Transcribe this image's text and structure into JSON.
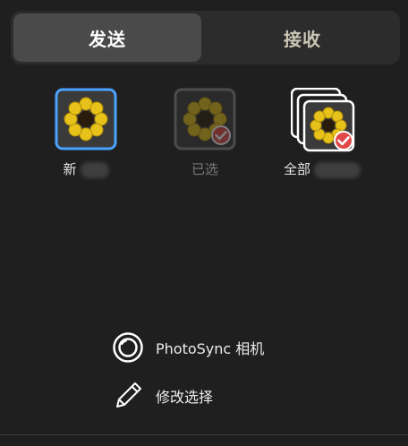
{
  "tabs": {
    "send_label": "发送",
    "receive_label": "接收"
  },
  "albums": {
    "new_label": "新",
    "selected_label": "已选",
    "all_label": "全部"
  },
  "actions": {
    "camera_label": "PhotoSync 相机",
    "edit_label": "修改选择"
  },
  "colors": {
    "accent": "#4aa3ff",
    "check_red": "#e04848",
    "flower_yellow": "#e6c21a"
  },
  "icons": {
    "camera": "camera-icon",
    "edit": "pencil-icon",
    "check": "checkmark-badge-icon"
  }
}
